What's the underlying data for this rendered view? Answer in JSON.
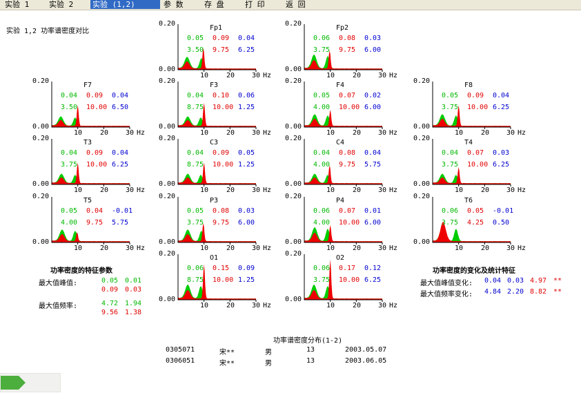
{
  "menu": [
    {
      "label": "实验 1",
      "active": false
    },
    {
      "label": "实验 2",
      "active": false
    },
    {
      "label": "实验 (1,2)",
      "active": true
    },
    {
      "label": "参 数",
      "active": false
    },
    {
      "label": "存 盘",
      "active": false
    },
    {
      "label": "打 印",
      "active": false
    },
    {
      "label": "返 回",
      "active": false
    }
  ],
  "page_title": "实验 1,2 功率谱密度对比",
  "axis": {
    "y_top": "0.20",
    "y_bottom": "0.00",
    "x_ticks": [
      "10",
      "20",
      "30"
    ],
    "x_unit": "Hz"
  },
  "colors": {
    "exp1": "#00cc00",
    "exp2": "#ee0000",
    "diff": "#0000d0"
  },
  "chart_data": {
    "type": "area",
    "x_range": [
      0,
      30
    ],
    "y_range": [
      0,
      0.2
    ],
    "x_unit": "Hz",
    "series_names": [
      "实验 1",
      "实验 2"
    ],
    "channels": [
      {
        "name": "Fp1",
        "peak": [
          "0.05",
          "0.09",
          "0.04"
        ],
        "freq": [
          "3.50",
          "9.75",
          "6.25"
        ]
      },
      {
        "name": "Fp2",
        "peak": [
          "0.06",
          "0.08",
          "0.03"
        ],
        "freq": [
          "3.75",
          "9.75",
          "6.00"
        ]
      },
      {
        "name": "F7",
        "peak": [
          "0.04",
          "0.09",
          "0.04"
        ],
        "freq": [
          "3.50",
          "10.00",
          "6.50"
        ]
      },
      {
        "name": "F3",
        "peak": [
          "0.04",
          "0.10",
          "0.06"
        ],
        "freq": [
          "8.75",
          "10.00",
          "1.25"
        ]
      },
      {
        "name": "F4",
        "peak": [
          "0.05",
          "0.07",
          "0.02"
        ],
        "freq": [
          "4.00",
          "10.00",
          "6.00"
        ]
      },
      {
        "name": "F8",
        "peak": [
          "0.05",
          "0.09",
          "0.04"
        ],
        "freq": [
          "3.75",
          "10.00",
          "6.25"
        ]
      },
      {
        "name": "T3",
        "peak": [
          "0.04",
          "0.09",
          "0.04"
        ],
        "freq": [
          "3.75",
          "10.00",
          "6.25"
        ]
      },
      {
        "name": "C3",
        "peak": [
          "0.04",
          "0.09",
          "0.05"
        ],
        "freq": [
          "8.75",
          "10.00",
          "1.25"
        ]
      },
      {
        "name": "C4",
        "peak": [
          "0.04",
          "0.08",
          "0.04"
        ],
        "freq": [
          "4.00",
          "9.75",
          "5.75"
        ]
      },
      {
        "name": "T4",
        "peak": [
          "0.04",
          "0.07",
          "0.03"
        ],
        "freq": [
          "3.75",
          "10.00",
          "6.25"
        ]
      },
      {
        "name": "T5",
        "peak": [
          "0.05",
          "0.04",
          "-0.01"
        ],
        "freq": [
          "4.00",
          "9.75",
          "5.75"
        ]
      },
      {
        "name": "P3",
        "peak": [
          "0.05",
          "0.08",
          "0.03"
        ],
        "freq": [
          "3.75",
          "9.75",
          "6.00"
        ]
      },
      {
        "name": "P4",
        "peak": [
          "0.06",
          "0.07",
          "0.01"
        ],
        "freq": [
          "4.00",
          "10.00",
          "6.00"
        ]
      },
      {
        "name": "T6",
        "peak": [
          "0.06",
          "0.05",
          "-0.01"
        ],
        "freq": [
          "3.75",
          "4.25",
          "0.50"
        ]
      },
      {
        "name": "O1",
        "peak": [
          "0.06",
          "0.15",
          "0.09"
        ],
        "freq": [
          "8.75",
          "10.00",
          "1.25"
        ]
      },
      {
        "name": "O2",
        "peak": [
          "0.06",
          "0.17",
          "0.12"
        ],
        "freq": [
          "3.75",
          "10.00",
          "6.25"
        ]
      }
    ]
  },
  "feature_params": {
    "title": "功率密度的特征参数",
    "peak_label": "最大值峰值:",
    "peak_values": [
      [
        "0.05",
        "0.01"
      ],
      [
        "0.09",
        "0.03"
      ]
    ],
    "freq_label": "最大值频率:",
    "freq_values": [
      [
        "4.72",
        "1.94"
      ],
      [
        "9.56",
        "1.38"
      ]
    ]
  },
  "change_stats": {
    "title": "功率密度的变化及统计特征",
    "rows": [
      {
        "label": "最大值峰值变化:",
        "values": [
          "0.04",
          "0.03"
        ],
        "t": "4.97",
        "sig": "**"
      },
      {
        "label": "最大值频率变化:",
        "values": [
          "4.84",
          "2.20"
        ],
        "t": "8.82",
        "sig": "**"
      }
    ]
  },
  "distribution": {
    "title": "功率谱密度分布(1-2)",
    "rows": [
      {
        "id": "0305071",
        "name": "宋**",
        "sex": "男",
        "age": "13",
        "date": "2003.05.07"
      },
      {
        "id": "0306051",
        "name": "宋**",
        "sex": "男",
        "age": "13",
        "date": "2003.06.05"
      }
    ]
  }
}
